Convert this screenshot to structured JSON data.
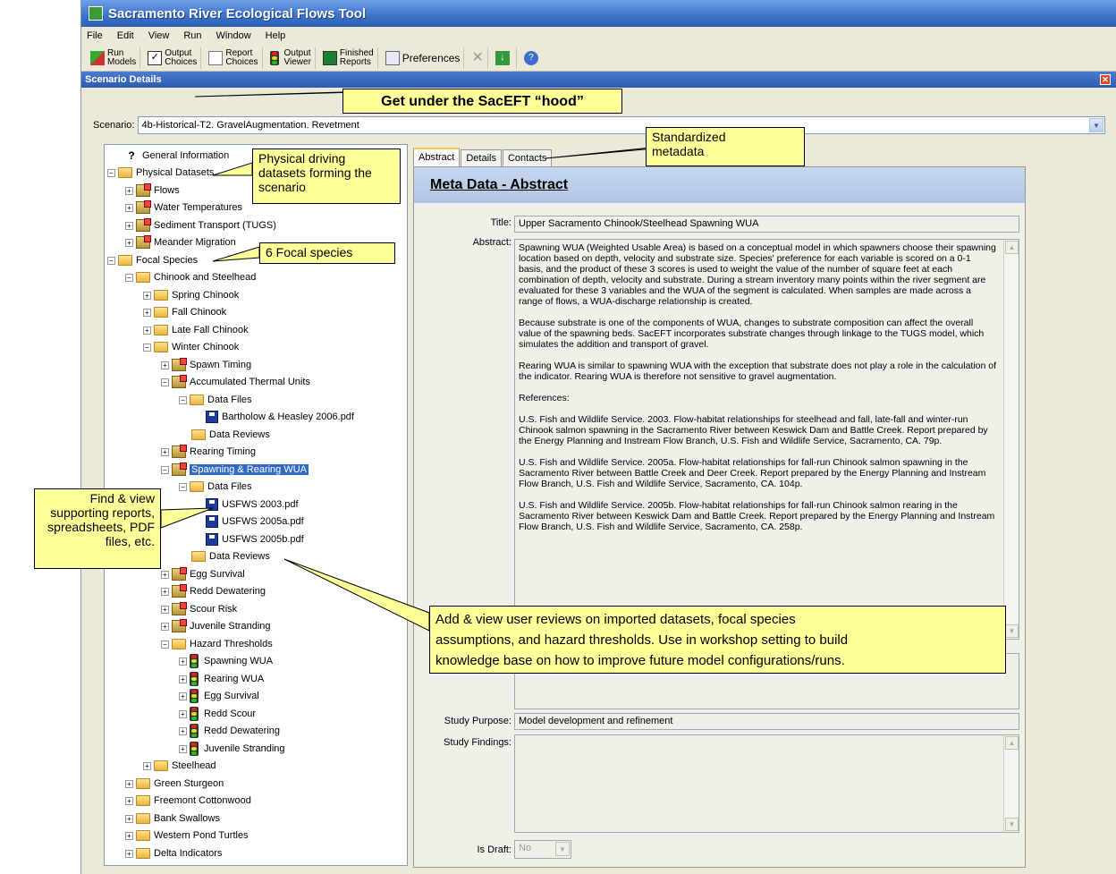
{
  "window": {
    "title": "Sacramento River Ecological Flows Tool"
  },
  "menu": [
    "File",
    "Edit",
    "View",
    "Run",
    "Window",
    "Help"
  ],
  "toolbar": [
    {
      "label": "Run\nModels",
      "icon": "run-models-icon"
    },
    {
      "label": "Output\nChoices",
      "icon": "checkbox-icon"
    },
    {
      "label": "Report\nChoices",
      "icon": "report-icon"
    },
    {
      "label": "Output\nViewer",
      "icon": "traffic-light-icon"
    },
    {
      "label": "Finished\nReports",
      "icon": "excel-icon"
    },
    {
      "label": "Preferences",
      "icon": "preferences-icon"
    }
  ],
  "panel": {
    "title": "Scenario Details"
  },
  "scenario": {
    "label": "Scenario:",
    "value": "4b-Historical-T2. GravelAugmentation. Revetment"
  },
  "tree": [
    {
      "label": "General Information"
    },
    {
      "label": "Physical Datasets"
    },
    {
      "label": "Flows"
    },
    {
      "label": "Water Temperatures"
    },
    {
      "label": "Sediment Transport (TUGS)"
    },
    {
      "label": "Meander Migration"
    },
    {
      "label": "Focal Species"
    },
    {
      "label": "Chinook and Steelhead"
    },
    {
      "label": "Spring Chinook"
    },
    {
      "label": "Fall Chinook"
    },
    {
      "label": "Late Fall Chinook"
    },
    {
      "label": "Winter Chinook"
    },
    {
      "label": "Spawn Timing"
    },
    {
      "label": "Accumulated Thermal Units"
    },
    {
      "label": "Data Files"
    },
    {
      "label": "Bartholow & Heasley 2006.pdf"
    },
    {
      "label": "Data Reviews"
    },
    {
      "label": "Rearing Timing"
    },
    {
      "label": "Spawning & Rearing WUA"
    },
    {
      "label": "Data Files"
    },
    {
      "label": "USFWS 2003.pdf"
    },
    {
      "label": "USFWS 2005a.pdf"
    },
    {
      "label": "USFWS 2005b.pdf"
    },
    {
      "label": "Data Reviews"
    },
    {
      "label": "Egg Survival"
    },
    {
      "label": "Redd Dewatering"
    },
    {
      "label": "Scour Risk"
    },
    {
      "label": "Juvenile Stranding"
    },
    {
      "label": "Hazard Thresholds"
    },
    {
      "label": "Spawning WUA"
    },
    {
      "label": "Rearing WUA"
    },
    {
      "label": "Egg Survival"
    },
    {
      "label": "Redd Scour"
    },
    {
      "label": "Redd Dewatering"
    },
    {
      "label": "Juvenile Stranding"
    },
    {
      "label": "Steelhead"
    },
    {
      "label": "Green Sturgeon"
    },
    {
      "label": "Freemont Cottonwood"
    },
    {
      "label": "Bank Swallows"
    },
    {
      "label": "Western Pond Turtles"
    },
    {
      "label": "Delta Indicators"
    }
  ],
  "tabs": [
    "Abstract",
    "Details",
    "Contacts"
  ],
  "meta": {
    "header": "Meta Data - Abstract",
    "title_label": "Title:",
    "title_value": "Upper Sacramento Chinook/Steelhead Spawning WUA",
    "abstract_label": "Abstract:",
    "abstract_paragraphs": [
      "Spawning WUA (Weighted Usable Area) is based on a conceptual model in which spawners choose their spawning location based on depth, velocity and substrate size. Species' preference for each variable is scored on a 0-1 basis, and the product of these 3 scores is used to weight the value of the number of square feet at each combination of depth, velocity and substrate. During a stream inventory many points within the river segment are evaluated for these 3 variables and the WUA of the segment is calculated. When samples are made across a range of flows, a WUA-discharge relationship is created.",
      "Because substrate is one of the components of WUA, changes to substrate composition can affect the overall value of the spawning beds. SacEFT incorporates substrate changes through linkage to the TUGS model, which simulates the addition and transport of gravel.",
      "Rearing WUA is similar to spawning WUA with the exception that substrate does not play a role in the calculation of the indicator.  Rearing WUA is therefore not sensitive to gravel augmentation.",
      "References:",
      "U.S. Fish and Wildlife Service. 2003. Flow-habitat relationships for steelhead and fall, late-fall and winter-run Chinook salmon spawning in the Sacramento River between Keswick Dam and Battle Creek. Report prepared by the Energy Planning and Instream Flow Branch, U.S. Fish and Wildlife Service, Sacramento, CA. 79p.",
      "U.S. Fish and Wildlife Service. 2005a. Flow-habitat relationships for fall-run Chinook salmon spawning in the Sacramento River between Battle Creek and Deer Creek. Report prepared by the Energy Planning and Instream Flow Branch, U.S. Fish and Wildlife Service, Sacramento, CA. 104p.",
      "U.S. Fish and Wildlife Service. 2005b. Flow-habitat relationships for fall-run Chinook salmon rearing in the Sacramento River between Keswick Dam and Battle Creek. Report prepared by the Energy Planning and Instream Flow Branch, U.S. Fish and Wildlife Service, Sacramento, CA. 258p."
    ],
    "purpose_label": "Study Purpose:",
    "purpose_value": "Model development and refinement",
    "findings_label": "Study Findings:",
    "draft_label": "Is Draft:",
    "draft_value": "No"
  },
  "callouts": {
    "hood": "Get under the SacEFT “hood”",
    "metadata": "Standardized\nmetadata",
    "physical": "Physical driving\ndatasets forming the\nscenario",
    "focal": "6 Focal species",
    "find": "Find & view\nsupporting reports,\nspreadsheets, PDF\nfiles, etc.",
    "reviews": "Add & view user reviews on imported datasets, focal species\nassumptions, and hazard thresholds.  Use in workshop setting to build\nknowledge base on how to improve future model configurations/runs."
  }
}
